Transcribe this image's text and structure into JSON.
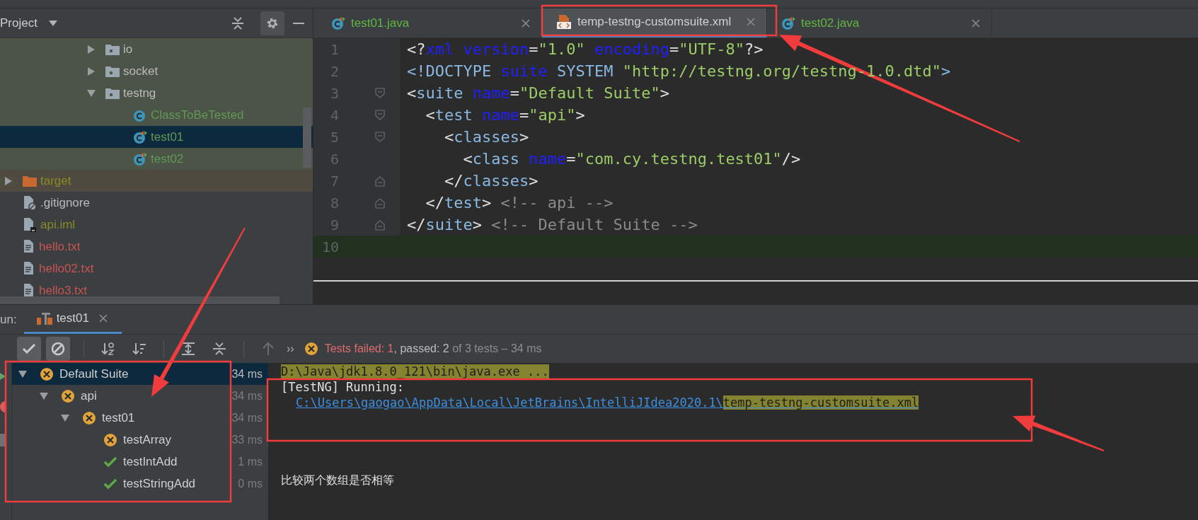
{
  "project_panel": {
    "title": "Project",
    "tree": {
      "partial_branch": [
        {
          "label": "io",
          "kind": "folder",
          "expanded": false,
          "selected": false,
          "color": "#bbbbbb"
        },
        {
          "label": "socket",
          "kind": "folder",
          "expanded": false,
          "selected": false,
          "color": "#bbbbbb"
        },
        {
          "label": "testng",
          "kind": "folder",
          "expanded": true,
          "selected": false,
          "color": "#bbbbbb",
          "children": [
            {
              "label": "ClassToBeTested",
              "kind": "class",
              "selected": false,
              "color": "#629755"
            },
            {
              "label": "test01",
              "kind": "test-class",
              "selected": true,
              "color": "#629755"
            },
            {
              "label": "test02",
              "kind": "test-class",
              "selected": false,
              "color": "#629755"
            }
          ]
        }
      ],
      "items": [
        {
          "label": "target",
          "kind": "excluded-folder",
          "expanded": false,
          "selected": false,
          "color": "#8a8a22"
        },
        {
          "label": ".gitignore",
          "kind": "ignore-file",
          "selected": false,
          "color": "#bbbbbb"
        },
        {
          "label": "api.iml",
          "kind": "module-file",
          "selected": false,
          "color": "#8a8a22"
        },
        {
          "label": "hello.txt",
          "kind": "text-file",
          "selected": false,
          "color": "#c75450"
        },
        {
          "label": "hello02.txt",
          "kind": "text-file",
          "selected": false,
          "color": "#c75450"
        },
        {
          "label": "hello3.txt",
          "kind": "text-file",
          "selected": false,
          "color": "#c75450"
        }
      ]
    }
  },
  "editor": {
    "tabs": [
      {
        "label": "test01.java",
        "kind": "test-class",
        "selected": false,
        "color": "#62b543"
      },
      {
        "label": "temp-testng-customsuite.xml",
        "kind": "xml",
        "selected": true,
        "color": "#cfcfcf"
      },
      {
        "label": "test02.java",
        "kind": "test-class",
        "selected": false,
        "color": "#62b543"
      }
    ],
    "lines": [
      {
        "number": "1",
        "current": false,
        "kind": "plain",
        "text": "<?xml version=\"1.0\" encoding=\"UTF-8\"?>"
      },
      {
        "number": "2",
        "current": false,
        "kind": "plain",
        "text": "<!DOCTYPE suite SYSTEM \"http://testng.org/testng-1.0.dtd\">"
      },
      {
        "number": "3",
        "current": false,
        "kind": "fold-start",
        "text": "<suite name=\"Default Suite\">"
      },
      {
        "number": "4",
        "current": false,
        "kind": "fold-start",
        "text": "  <test name=\"api\">"
      },
      {
        "number": "5",
        "current": false,
        "kind": "fold-start",
        "text": "    <classes>"
      },
      {
        "number": "6",
        "current": false,
        "kind": "plain",
        "text": "      <class name=\"com.cy.testng.test01\"/>"
      },
      {
        "number": "7",
        "current": false,
        "kind": "fold-end",
        "text": "    </classes>"
      },
      {
        "number": "8",
        "current": false,
        "kind": "fold-end",
        "text": "  </test> <!-- api -->"
      },
      {
        "number": "9",
        "current": false,
        "kind": "fold-end",
        "text": "</suite> <!-- Default Suite -->"
      },
      {
        "number": "10",
        "current": true,
        "kind": "plain"
      }
    ]
  },
  "run_panel": {
    "label": "un:",
    "tab": {
      "label": "test01",
      "selected": true
    },
    "filters": [
      {
        "kind": "show-passed",
        "on": true
      },
      {
        "kind": "show-ignored",
        "on": true
      }
    ],
    "actions": [
      {
        "kind": "sort-alpha",
        "disabled": false
      },
      {
        "kind": "sort-duration",
        "disabled": false
      },
      {
        "kind": "expand-all",
        "disabled": false
      },
      {
        "kind": "collapse-all",
        "disabled": false
      },
      {
        "kind": "previous",
        "disabled": true
      }
    ],
    "more_label": "››",
    "status": [
      {
        "text": "Tests failed: 1",
        "kind": "failed"
      },
      {
        "text": ", passed: 2",
        "kind": "normal"
      },
      {
        "text": " of 3 tests – 34 ms",
        "kind": "muted"
      }
    ],
    "tests": [
      {
        "name": "Default Suite",
        "time": "34 ms",
        "failed": true,
        "expanded": true,
        "selected": true,
        "children": [
          {
            "name": "api",
            "time": "34 ms",
            "failed": true,
            "expanded": true,
            "selected": false,
            "children": [
              {
                "name": "test01",
                "time": "34 ms",
                "failed": true,
                "expanded": true,
                "selected": false,
                "children": [
                  {
                    "name": "testArray",
                    "time": "33 ms",
                    "failed": true,
                    "selected": false
                  },
                  {
                    "name": "testIntAdd",
                    "time": "1 ms",
                    "failed": false,
                    "selected": false
                  },
                  {
                    "name": "testStringAdd",
                    "time": "0 ms",
                    "failed": false,
                    "selected": false
                  }
                ]
              }
            ]
          }
        ]
      }
    ],
    "console": {
      "lines": [
        {
          "kind": "plain",
          "segments": [
            {
              "text": "D:\\Java\\jdk1.8.0_121\\bin\\java.exe ...",
              "kind": "highlight"
            }
          ]
        },
        {
          "kind": "plain",
          "segments": [
            {
              "text": "[TestNG] Running:",
              "kind": "plain"
            }
          ]
        },
        {
          "kind": "indented",
          "segments": [
            {
              "text": "C:\\Users\\gaogao\\AppData\\Local\\JetBrains\\IntelliJIdea2020.1\\",
              "kind": "link"
            },
            {
              "text": "temp-testng-customsuite.xml",
              "kind": "link-highlight"
            }
          ]
        }
      ],
      "output": "比较两个数组是否相等"
    }
  }
}
